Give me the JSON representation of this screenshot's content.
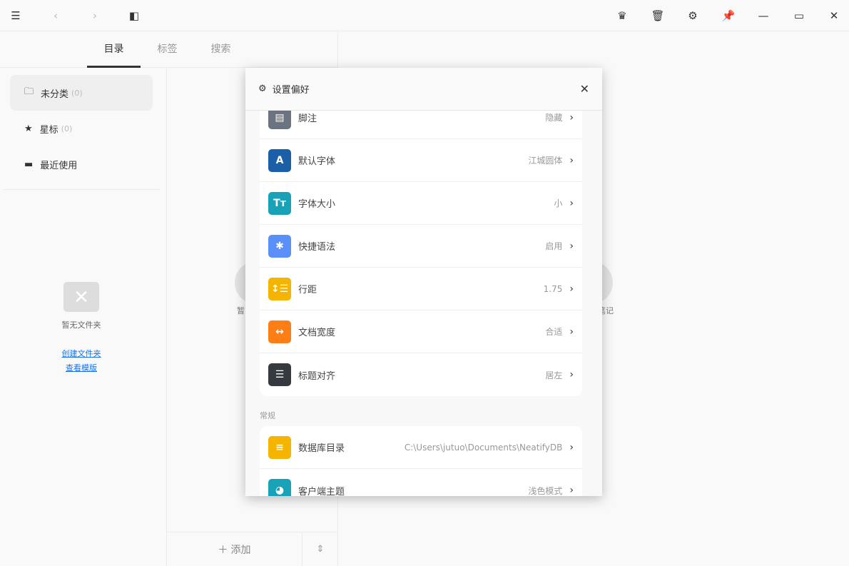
{
  "titlebar": {
    "icons": [
      "menu-icon",
      "back-icon",
      "forward-icon",
      "sidebar-toggle-icon",
      "crown-icon",
      "trash-icon",
      "gear-icon",
      "pin-icon",
      "minimize-icon",
      "maximize-icon",
      "close-icon"
    ]
  },
  "tabs": [
    {
      "label": "目录"
    },
    {
      "label": "标签"
    },
    {
      "label": "搜索"
    }
  ],
  "sidebar": {
    "items": [
      {
        "label": "未分类",
        "count": "(0)"
      },
      {
        "label": "星标",
        "count": "(0)"
      },
      {
        "label": "最近使用"
      }
    ],
    "empty": {
      "text": "暂无文件夹",
      "create_link": "创建文件夹",
      "template_link": "查看模版"
    }
  },
  "middle": {
    "add_label": "添加",
    "bg_left": "暂",
    "bg_right": "笔记"
  },
  "modal": {
    "title": "设置偏好",
    "editor_items": [
      {
        "label": "脚注",
        "value": "隐藏",
        "color": "#6b7280",
        "glyph": "▤"
      },
      {
        "label": "默认字体",
        "value": "江城圆体",
        "color": "#1a5fa8",
        "glyph": "A"
      },
      {
        "label": "字体大小",
        "value": "小",
        "color": "#17a2b8",
        "glyph": "Tт"
      },
      {
        "label": "快捷语法",
        "value": "启用",
        "color": "#5b8ff9",
        "glyph": "✱"
      },
      {
        "label": "行距",
        "value": "1.75",
        "color": "#f5b400",
        "glyph": "↕☰"
      },
      {
        "label": "文档宽度",
        "value": "合适",
        "color": "#fd7e14",
        "glyph": "↔"
      },
      {
        "label": "标题对齐",
        "value": "居左",
        "color": "#343a40",
        "glyph": "☰"
      }
    ],
    "section_general": "常规",
    "general_items": [
      {
        "label": "数据库目录",
        "value": "C:\\Users\\jutuo\\Documents\\NeatifyDB",
        "color": "#f5b400",
        "glyph": "≡"
      },
      {
        "label": "客户端主题",
        "value": "浅色模式",
        "color": "#17a2b8",
        "glyph": "◕"
      }
    ]
  }
}
